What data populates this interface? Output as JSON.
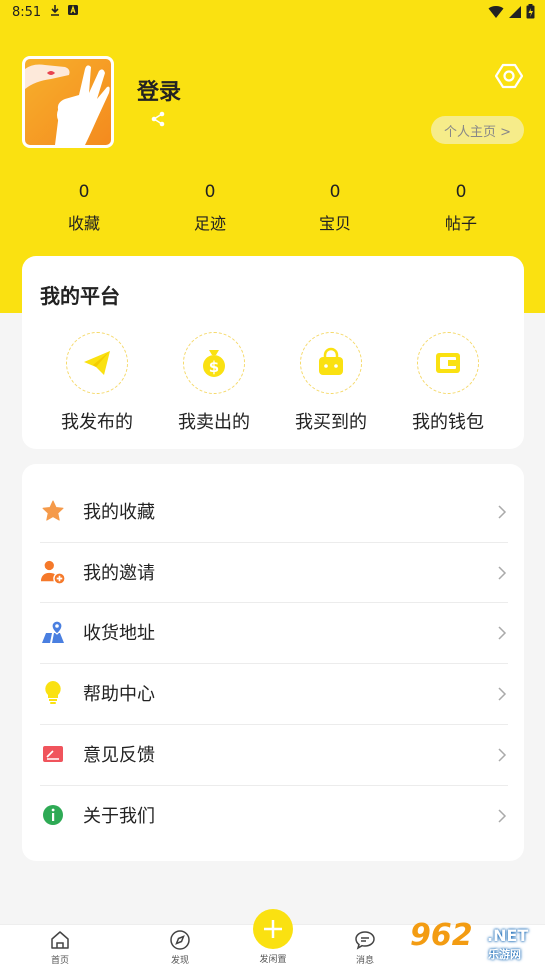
{
  "status_bar": {
    "time": "8:51"
  },
  "profile": {
    "username": "登录",
    "homepage_label": "个人主页 >"
  },
  "stats": [
    {
      "value": "0",
      "label": "收藏"
    },
    {
      "value": "0",
      "label": "足迹"
    },
    {
      "value": "0",
      "label": "宝贝"
    },
    {
      "value": "0",
      "label": "帖子"
    }
  ],
  "platform": {
    "title": "我的平台",
    "items": [
      {
        "label": "我发布的",
        "icon": "paper-plane-icon"
      },
      {
        "label": "我卖出的",
        "icon": "money-bag-icon"
      },
      {
        "label": "我买到的",
        "icon": "shopping-bag-icon"
      },
      {
        "label": "我的钱包",
        "icon": "wallet-icon"
      }
    ]
  },
  "menu": [
    {
      "label": "我的收藏",
      "icon": "star-icon"
    },
    {
      "label": "我的邀请",
      "icon": "add-user-icon"
    },
    {
      "label": "收货地址",
      "icon": "map-pin-icon"
    },
    {
      "label": "帮助中心",
      "icon": "lightbulb-icon"
    },
    {
      "label": "意见反馈",
      "icon": "feedback-icon"
    },
    {
      "label": "关于我们",
      "icon": "info-icon"
    }
  ],
  "tabbar": {
    "home": "首页",
    "discover": "发现",
    "publish": "发闲置",
    "messages": "消息"
  },
  "watermark": {
    "brand": "962",
    "domain": ".NET",
    "sub": "乐游网"
  },
  "colors": {
    "accent": "#fae111",
    "background": "#f5f5f5"
  }
}
